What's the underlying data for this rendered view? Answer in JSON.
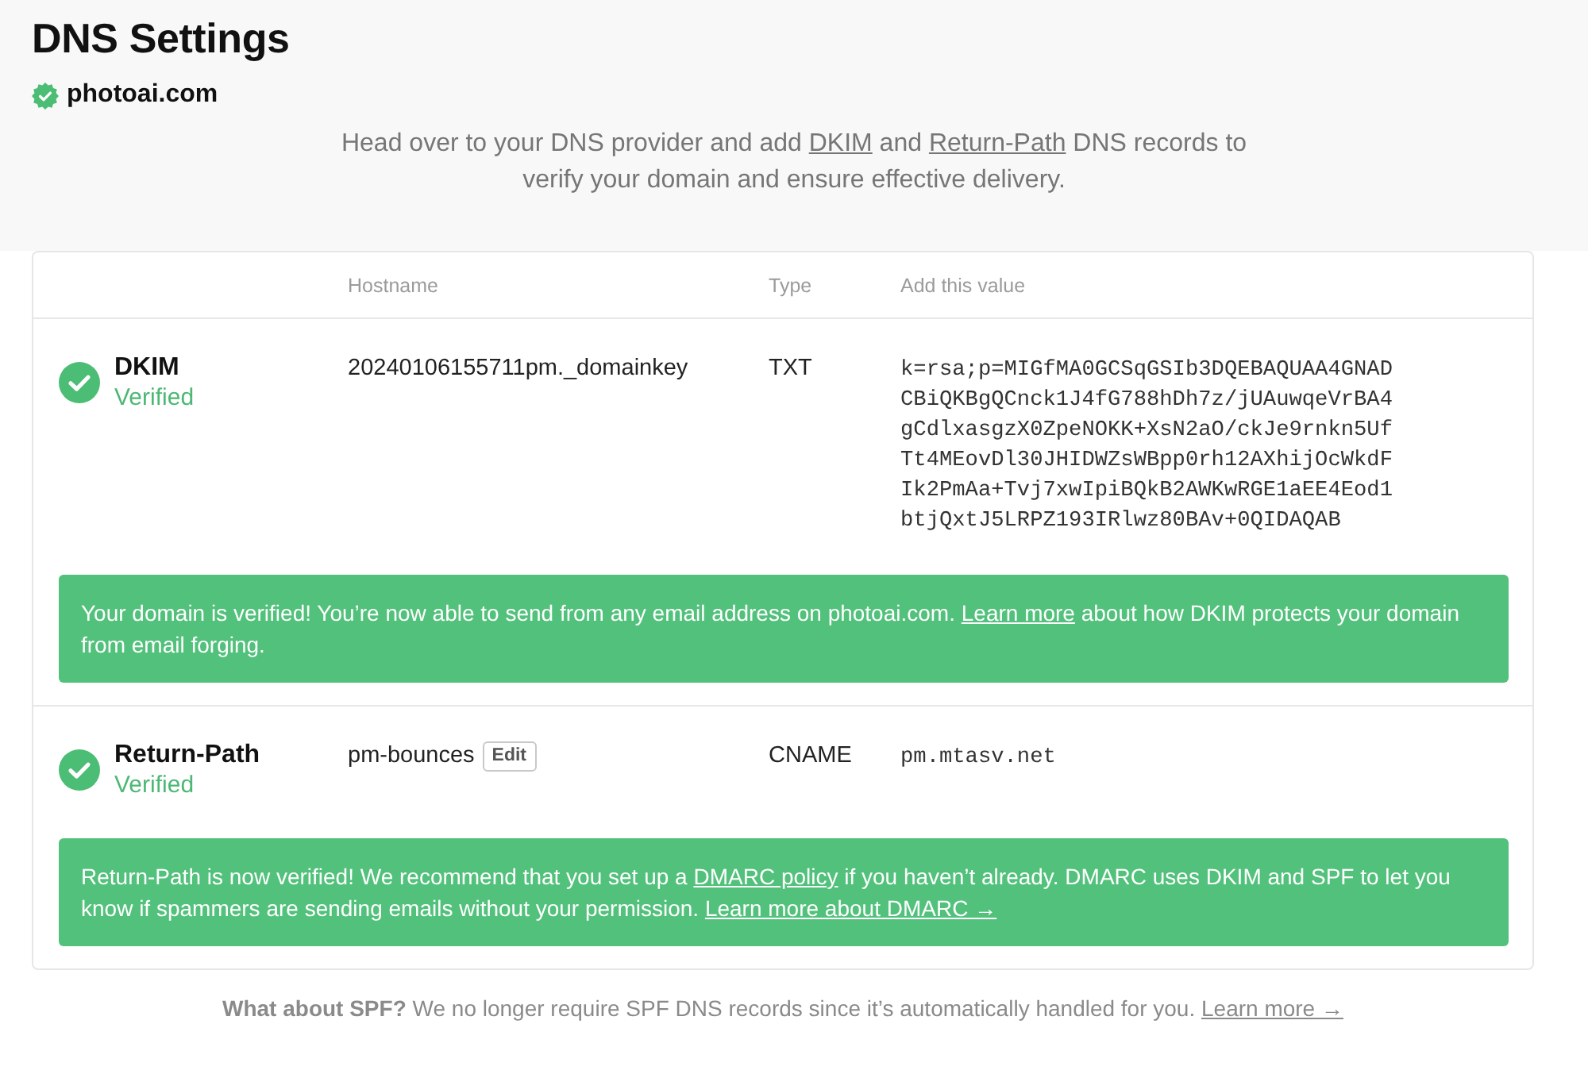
{
  "page": {
    "title": "DNS Settings",
    "domain": "photoai.com"
  },
  "intro": [
    {
      "kind": "text",
      "text": "Head over to your DNS provider and add "
    },
    {
      "kind": "link",
      "text": "DKIM"
    },
    {
      "kind": "text",
      "text": " and "
    },
    {
      "kind": "link",
      "text": "Return-Path"
    },
    {
      "kind": "text",
      "text": " DNS records to verify your domain and ensure effective delivery."
    }
  ],
  "table": {
    "columns": [
      "Hostname",
      "Type",
      "Add this value"
    ],
    "records": [
      {
        "name": "DKIM",
        "status": "Verified",
        "verified": true,
        "hostname": "20240106155711pm._domainkey",
        "type": "TXT",
        "value": "k=rsa;p=MIGfMA0GCSqGSIb3DQEBAQUAA4GNADCBiQKBgQCnck1J4fG788hDh7z/jUAuwqeVrBA4gCdlxasgzX0ZpeNOKK+XsN2aO/ckJe9rnkn5UfTt4MEovDl30JHIDWZsWBpp0rh12AXhijOcWkdFIk2PmAa+Tvj7xwIpiBQkB2AWKwRGE1aEE4Eod1btjQxtJ5LRPZ193IRlwz80BAv+0QIDAQAB",
        "notice": [
          {
            "kind": "text",
            "text": "Your domain is verified! You’re now able to send from any email address on photoai.com. "
          },
          {
            "kind": "link",
            "text": "Learn more"
          },
          {
            "kind": "text",
            "text": " about how DKIM protects your domain from email forging."
          }
        ]
      },
      {
        "name": "Return-Path",
        "status": "Verified",
        "verified": true,
        "hostname": "pm-bounces",
        "hostname_action": "Edit",
        "type": "CNAME",
        "value": "pm.mtasv.net",
        "notice": [
          {
            "kind": "text",
            "text": "Return-Path is now verified! We recommend that you set up a "
          },
          {
            "kind": "link",
            "text": "DMARC policy"
          },
          {
            "kind": "text",
            "text": " if you haven’t already. DMARC uses DKIM and SPF to let you know if spammers are sending emails without your permission. "
          },
          {
            "kind": "link",
            "text": "Learn more about DMARC →"
          }
        ]
      }
    ]
  },
  "footer": [
    {
      "kind": "text",
      "text": "**What about SPF?** We no longer require SPF DNS records since it’s automatically handled for you. "
    },
    {
      "kind": "link",
      "text": "Learn more →"
    }
  ]
}
